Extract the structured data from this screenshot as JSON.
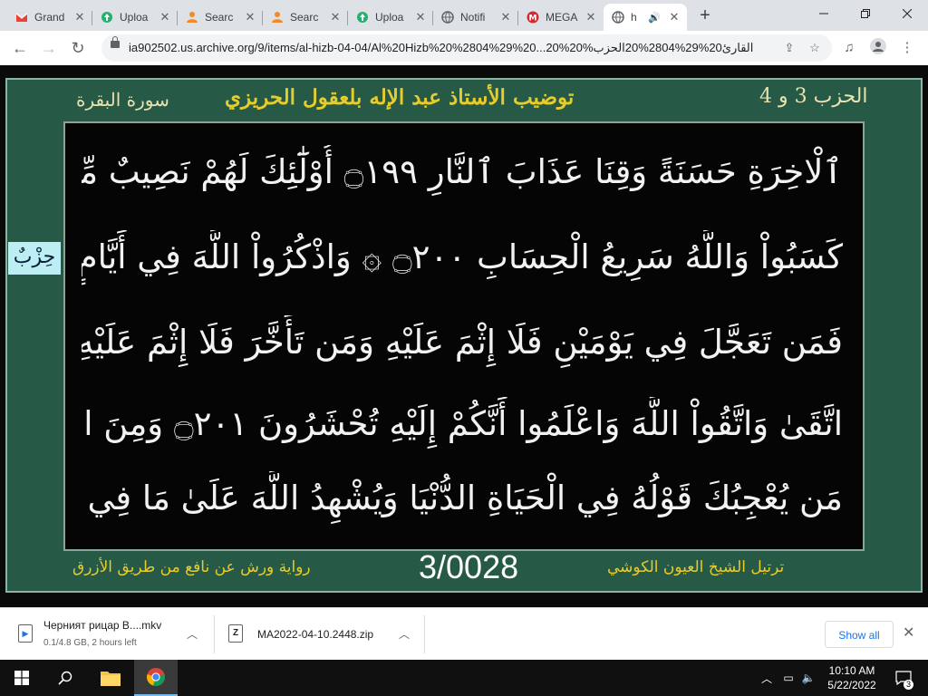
{
  "tabs": [
    {
      "title": "Grand",
      "icon": "gmail-icon",
      "active": false
    },
    {
      "title": "Uploa",
      "icon": "upload-icon",
      "active": false
    },
    {
      "title": "Searc",
      "icon": "search-icon",
      "active": false
    },
    {
      "title": "Searc",
      "icon": "search-icon",
      "active": false
    },
    {
      "title": "Uploa",
      "icon": "upload-icon",
      "active": false
    },
    {
      "title": "Notifi",
      "icon": "globe-icon",
      "active": false
    },
    {
      "title": "MEGA",
      "icon": "mega-icon",
      "active": false
    },
    {
      "title": "h",
      "icon": "globe-icon",
      "active": true
    }
  ],
  "toolbar": {
    "url": "ia902502.us.archive.org/9/items/al-hizb-04-04/Al%20Hizb%20%2804%29%20...20%القارئ20%29%2804%20الحزب%20"
  },
  "header": {
    "hizb": "الحزب 3 و 4",
    "title": "توضيب الأستاذ عبد الإله بلعقول الحريزي",
    "surah": "سورة البقرة"
  },
  "quran_lines": [
    "ٱلْاخِرَةِ حَسَنَةً وَقِنَا عَذَابَ ٱلنَّارِ ۝١٩٩ أُوْلَٰٓئِكَ لَهُمْ نَصِيبٌ مِّمَّا",
    "كَسَبُواْ وَاللَّهُ سَرِيعُ الْحِسَابِ ۝٢٠٠ ۞ وَاذْكُرُواْ اللَّهَ فِي أَيَّامٍ مَّعْدُودَاتٍ",
    "فَمَن تَعَجَّلَ فِي يَوْمَيْنِ فَلَا إِثْمَ عَلَيْهِ وَمَن تَأَخَّرَ فَلَا إِثْمَ عَلَيْهِ لِمَنِ",
    "اتَّقَىٰ وَاتَّقُواْ اللَّهَ وَاعْلَمُوا أَنَّكُمْ إِلَيْهِ تُحْشَرُونَ ۝٢٠١ وَمِنَ النَّاسِ",
    "مَن يُعْجِبُكَ قَوْلُهُ فِي الْحَيَاةِ الدُّنْيَا وَيُشْهِدُ اللَّهَ عَلَىٰ مَا فِي قَلْبِهِ"
  ],
  "hizb_badge": "حِزْبٌ",
  "footer": {
    "riwaya": "رواية ورش عن نافع من طريق الأزرق",
    "page": "3/0028",
    "reciter": "ترتيل الشيخ العيون الكوشي"
  },
  "downloads": [
    {
      "name": "Черният рицар В....mkv",
      "status": "0.1/4.8 GB, 2 hours left",
      "icon": "video-file-icon"
    },
    {
      "name": "MA2022-04-10.2448.zip",
      "status": "",
      "icon": "zip-file-icon"
    }
  ],
  "download_bar": {
    "show_all": "Show all"
  },
  "taskbar": {
    "time": "10:10 AM",
    "date": "5/22/2022",
    "notifications": "3"
  }
}
